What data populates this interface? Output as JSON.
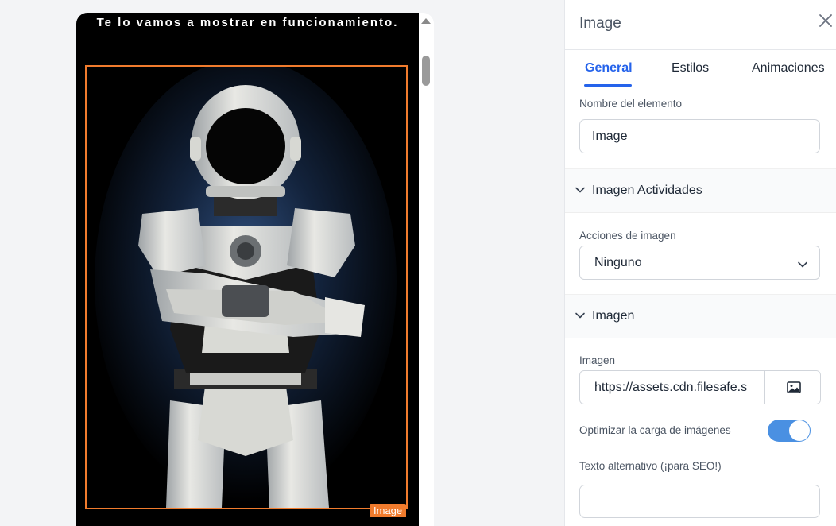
{
  "preview": {
    "headline": "Te lo vamos a mostrar en funcionamiento.",
    "image_tag": "Image"
  },
  "panel": {
    "title": "Image",
    "tabs": [
      "General",
      "Estilos",
      "Animaciones"
    ],
    "active_tab": "General",
    "element_name_label": "Nombre del elemento",
    "element_name_value": "Image",
    "section_activities": "Imagen Actividades",
    "image_actions_label": "Acciones de imagen",
    "image_actions_value": "Ninguno",
    "section_image": "Imagen",
    "image_label": "Imagen",
    "image_url": "https://assets.cdn.filesafe.s",
    "optimize_label": "Optimizar la carga de imágenes",
    "optimize_enabled": true,
    "alt_text_label": "Texto alternativo (¡para SEO!)",
    "alt_text_value": ""
  },
  "colors": {
    "accent": "#2563eb",
    "selection": "#f07b2d",
    "toggle_on": "#4a90e2"
  }
}
